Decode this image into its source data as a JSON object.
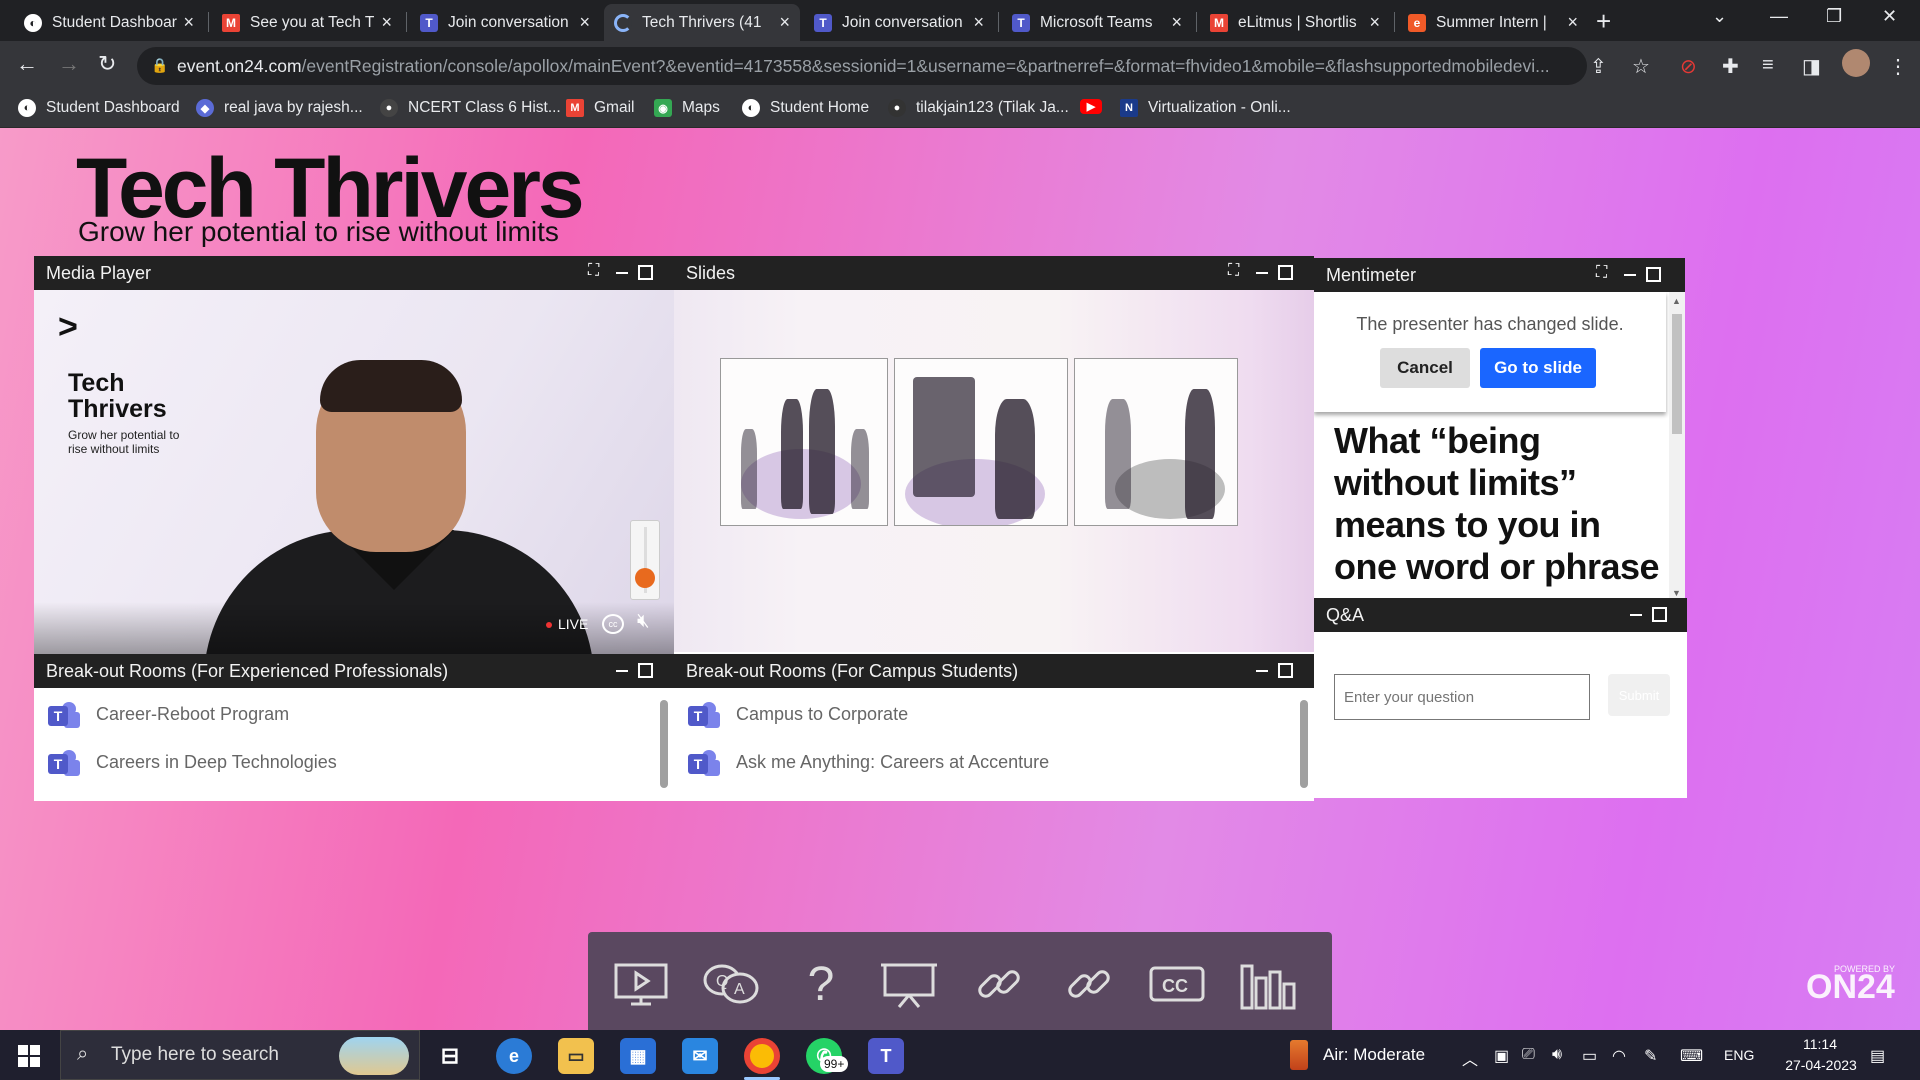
{
  "browser": {
    "tabs": [
      {
        "label": "Student Dashboard",
        "icon": "chrome-icon"
      },
      {
        "label": "See you at Tech T",
        "icon": "gmail-icon"
      },
      {
        "label": "Join conversation",
        "icon": "teams-icon"
      },
      {
        "label": "Tech Thrivers (41",
        "icon": "loading-icon",
        "active": true
      },
      {
        "label": "Join conversation",
        "icon": "teams-icon"
      },
      {
        "label": "Microsoft Teams",
        "icon": "teams-icon"
      },
      {
        "label": "eLitmus | Shortlis",
        "icon": "gmail-icon"
      },
      {
        "label": "Summer Intern |",
        "icon": "edge-icon"
      }
    ],
    "url_host": "event.on24.com",
    "url_path": "/eventRegistration/console/apollox/mainEvent?&eventid=4173558&sessionid=1&username=&partnerref=&format=fhvideo1&mobile=&flashsupportedmobiledevi...",
    "bookmarks": [
      {
        "label": "Student Dashboard",
        "color": "#ffffff"
      },
      {
        "label": "real java by rajesh...",
        "color": "#5b6bd6"
      },
      {
        "label": "NCERT Class 6 Hist...",
        "color": "#444444"
      },
      {
        "label": "Gmail",
        "color": "#ea4335"
      },
      {
        "label": "Maps",
        "color": "#34a853"
      },
      {
        "label": "Student Home",
        "color": "#ffffff"
      },
      {
        "label": "tilakjain123 (Tilak Ja...",
        "color": "#333333"
      },
      {
        "label": "",
        "color": "#ff0000"
      },
      {
        "label": "Virtualization - Onli...",
        "color": "#1a3a8a"
      }
    ]
  },
  "event": {
    "title": "Tech Thrivers",
    "subtitle": "Grow her potential to rise without limits"
  },
  "media_player": {
    "title": "Media Player",
    "brand": "Tech Thrivers",
    "tagline": "Grow her potential to rise without limits",
    "live_label": "LIVE",
    "volume": 0.2
  },
  "slides": {
    "title": "Slides"
  },
  "mentimeter": {
    "title": "Mentimeter",
    "notice": "The presenter has changed slide.",
    "cancel_label": "Cancel",
    "goto_label": "Go to slide",
    "question": "What “being without limits” means to you in one word or phrase on"
  },
  "qa": {
    "title": "Q&A",
    "placeholder": "Enter your question",
    "submit_label": "Submit"
  },
  "breakout_experienced": {
    "title": "Break-out Rooms (For Experienced Professionals)",
    "items": [
      "Career-Reboot Program",
      "Careers in Deep Technologies"
    ]
  },
  "breakout_campus": {
    "title": "Break-out Rooms (For Campus Students)",
    "items": [
      "Campus to Corporate",
      "Ask me Anything: Careers at Accenture"
    ]
  },
  "dock": {
    "icons": [
      "media-player-icon",
      "q-and-a-icon",
      "help-icon",
      "slides-icon",
      "link-icon",
      "link-alt-icon",
      "closed-captions-icon",
      "poll-chart-icon"
    ]
  },
  "branding": {
    "powered_by": "POWERED BY",
    "on24": "ON24"
  },
  "taskbar": {
    "search_placeholder": "Type here to search",
    "whatsapp_badge": "99+",
    "air_quality": "Air: Moderate",
    "language": "ENG",
    "time": "11:14",
    "date": "27-04-2023"
  }
}
